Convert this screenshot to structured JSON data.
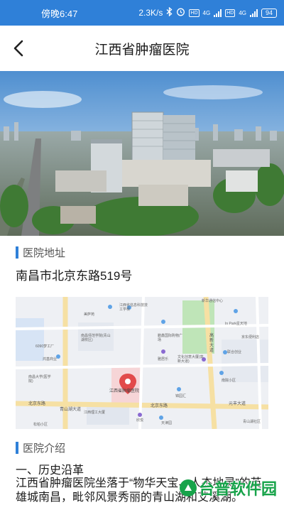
{
  "status_bar": {
    "time": "傍晚6:47",
    "net_speed": "2.3K/s",
    "sim1": "4G",
    "sim2": "4G",
    "hd1": "HD",
    "hd2": "HD",
    "battery": "94",
    "icons": [
      "bluetooth-icon",
      "alarm-icon",
      "hd-icon",
      "signal-icon",
      "battery-icon"
    ]
  },
  "nav": {
    "title": "江西省肿瘤医院",
    "back_icon": "chevron-left-icon"
  },
  "hero": {
    "image": "hospital aerial photo"
  },
  "address_section": {
    "heading": "医院地址",
    "address": "南昌市北京东路519号"
  },
  "map": {
    "labels": {
      "hospital_pin": "江西省肿瘤医院",
      "road_beijing_left": "北京东路",
      "road_beijing_right": "北京东路",
      "road_gaoxin": "高新大道",
      "road_qingshanhu": "青山湖大道",
      "road_yuanhuan": "元丰大道",
      "poi_1": "鹏鑫国际购物广场",
      "poi_2": "江西省信息科技技工学校",
      "poi_3": "雅居乐",
      "poi_4": "南昌师范学院(青山湖校区)",
      "poi_5": "江西理工大厦",
      "poi_6": "文化创意大厦(高新大道)",
      "poi_7": "In Park星天地",
      "poi_8": "联合创业",
      "poi_9": "南院小区",
      "poi_10": "南昌大学(医学院)",
      "poi_11": "鸿基商业",
      "poi_12": "6090梦工厂",
      "poi_13": "美萨苑",
      "poi_14": "京东便利店",
      "poi_15": "天津园",
      "poi_16": "青山湖社区",
      "poi_17": "松柏小区",
      "poi_18": "锦园汇",
      "poi_19": "欣悦",
      "poi_20": "新华通信中心"
    }
  },
  "intro_section": {
    "heading": "医院介绍",
    "subheading": "一、历史沿革",
    "paragraph": "江西省肿瘤医院坐落于“物华天宝、人杰地灵”的英雄城南昌，毗邻风景秀丽的青山湖和艾溪湖。"
  },
  "watermark": {
    "text": "台普软件园"
  },
  "colors": {
    "accent": "#2f80d8",
    "watermark": "#17a34a"
  }
}
